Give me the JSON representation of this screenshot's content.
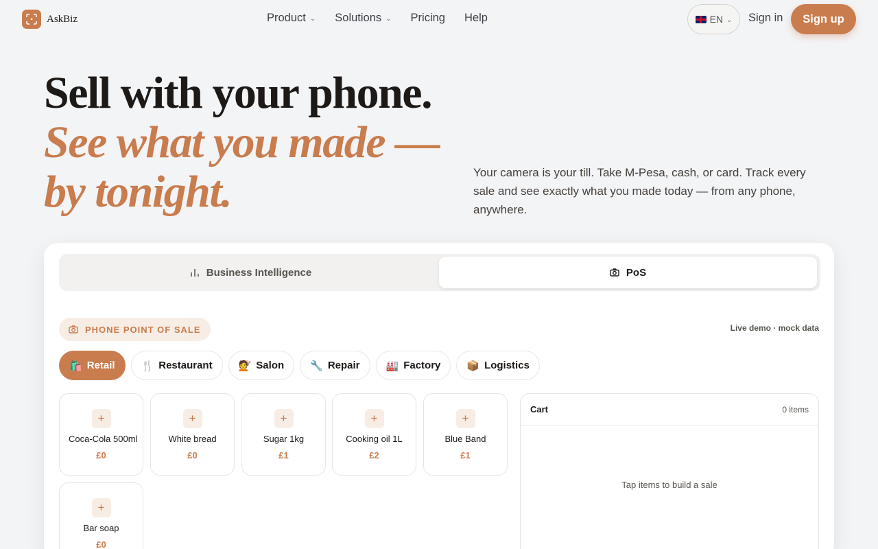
{
  "brand": {
    "name": "AskBiz"
  },
  "nav": {
    "links": [
      {
        "label": "Product",
        "has_menu": true
      },
      {
        "label": "Solutions",
        "has_menu": true
      },
      {
        "label": "Pricing",
        "has_menu": false
      },
      {
        "label": "Help",
        "has_menu": false
      }
    ],
    "language": "EN",
    "signin": "Sign in",
    "signup": "Sign up"
  },
  "hero": {
    "headline": "Sell with your phone.",
    "headline_accent": "See what you made — by tonight.",
    "subtext": "Your camera is your till. Take M-Pesa, cash, or card. Track every sale and see exactly what you made today — from any phone, anywhere."
  },
  "demo": {
    "tabs": [
      {
        "label": "Business Intelligence",
        "icon": "bar-chart-icon",
        "active": false
      },
      {
        "label": "PoS",
        "icon": "camera-icon",
        "active": true
      }
    ],
    "badge": "PHONE POINT OF SALE",
    "live_note": "Live demo · mock data",
    "categories": [
      {
        "emoji": "🛍️",
        "label": "Retail",
        "active": true
      },
      {
        "emoji": "🍴",
        "label": "Restaurant",
        "active": false
      },
      {
        "emoji": "💇",
        "label": "Salon",
        "active": false
      },
      {
        "emoji": "🔧",
        "label": "Repair",
        "active": false
      },
      {
        "emoji": "🏭",
        "label": "Factory",
        "active": false
      },
      {
        "emoji": "📦",
        "label": "Logistics",
        "active": false
      }
    ],
    "products": [
      {
        "name": "Coca-Cola 500ml",
        "price": "£0"
      },
      {
        "name": "White bread",
        "price": "£0"
      },
      {
        "name": "Sugar 1kg",
        "price": "£1"
      },
      {
        "name": "Cooking oil 1L",
        "price": "£2"
      },
      {
        "name": "Blue Band",
        "price": "£1"
      },
      {
        "name": "Bar soap",
        "price": "£0"
      }
    ],
    "cart": {
      "title": "Cart",
      "count": "0 items",
      "empty": "Tap items to build a sale"
    }
  },
  "colors": {
    "accent": "#c97c4d",
    "background": "#f3f4f6"
  }
}
